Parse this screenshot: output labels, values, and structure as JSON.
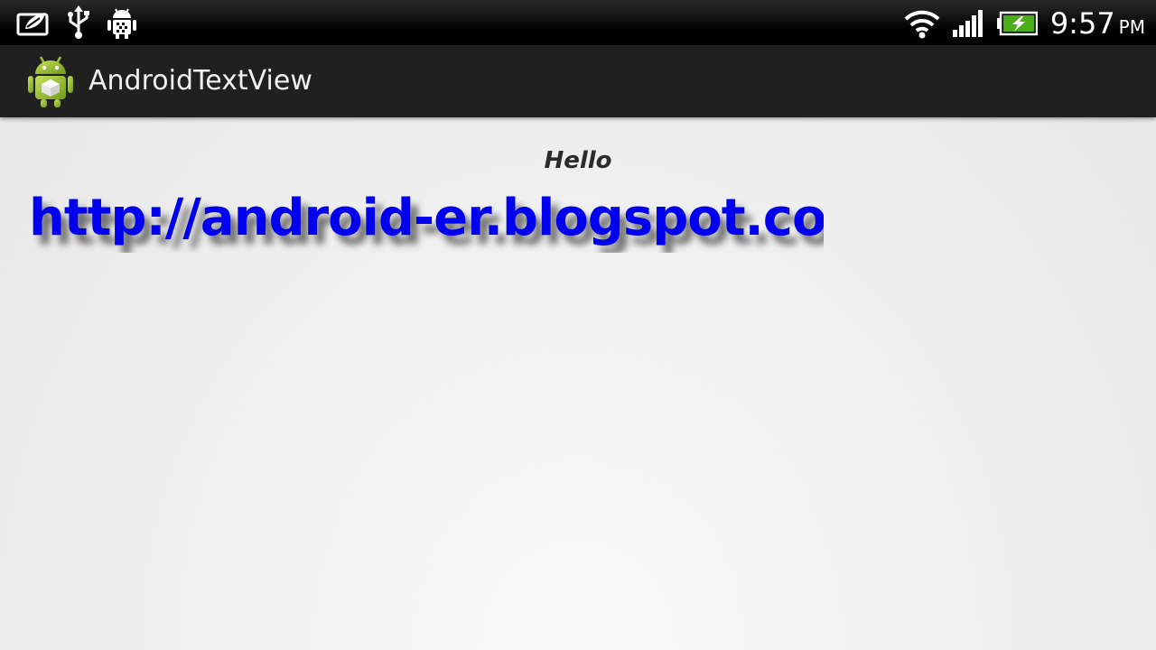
{
  "status_bar": {
    "left_icons": [
      "tablet-leaf-icon",
      "usb-icon",
      "android-debug-icon"
    ],
    "right_icons": [
      "wifi-icon",
      "signal-icon",
      "battery-charging-icon"
    ],
    "time": "9:57",
    "ampm": "PM",
    "colors": {
      "background": "#000000",
      "text": "#ffffff",
      "battery": "#4caf1a"
    }
  },
  "action_bar": {
    "app_icon": "android-app-icon",
    "title": "AndroidTextView",
    "colors": {
      "background": "#202020",
      "text": "#f0f0f0"
    }
  },
  "content": {
    "hello": "Hello",
    "link": "http://android-er.blogspot.com/",
    "colors": {
      "link": "#0000ee",
      "hello": "#2b2b2b"
    }
  }
}
